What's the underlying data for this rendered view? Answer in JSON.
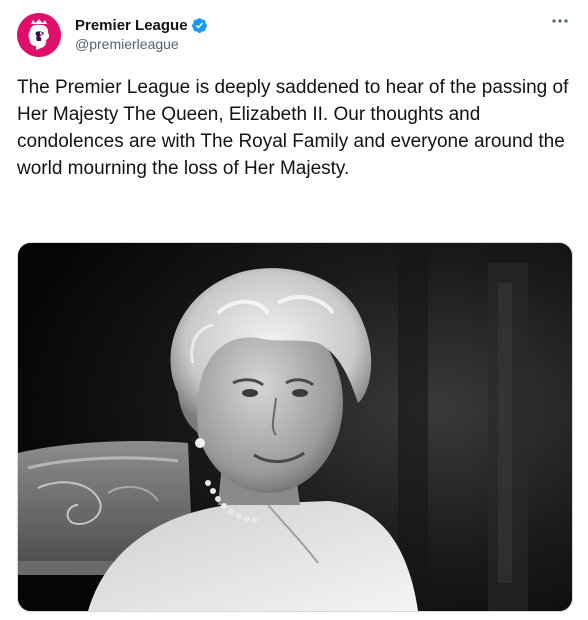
{
  "account": {
    "display_name": "Premier League",
    "handle": "@premierleague",
    "verified": true,
    "avatar_icon": "premier-league-lion-icon",
    "brand_color": "#e0106a"
  },
  "tweet": {
    "text": "The Premier League is deeply saddened to hear of the passing of Her Majesty The Queen, Elizabeth II. Our thoughts and condolences are with The Royal Family and everyone around the world mourning the loss of Her Majesty.",
    "more_icon": "more-options-icon"
  },
  "media": {
    "type": "photo",
    "style": "black-and-white portrait"
  },
  "colors": {
    "text_primary": "#0f1419",
    "text_secondary": "#536471",
    "verified_blue": "#1d9bf0"
  }
}
